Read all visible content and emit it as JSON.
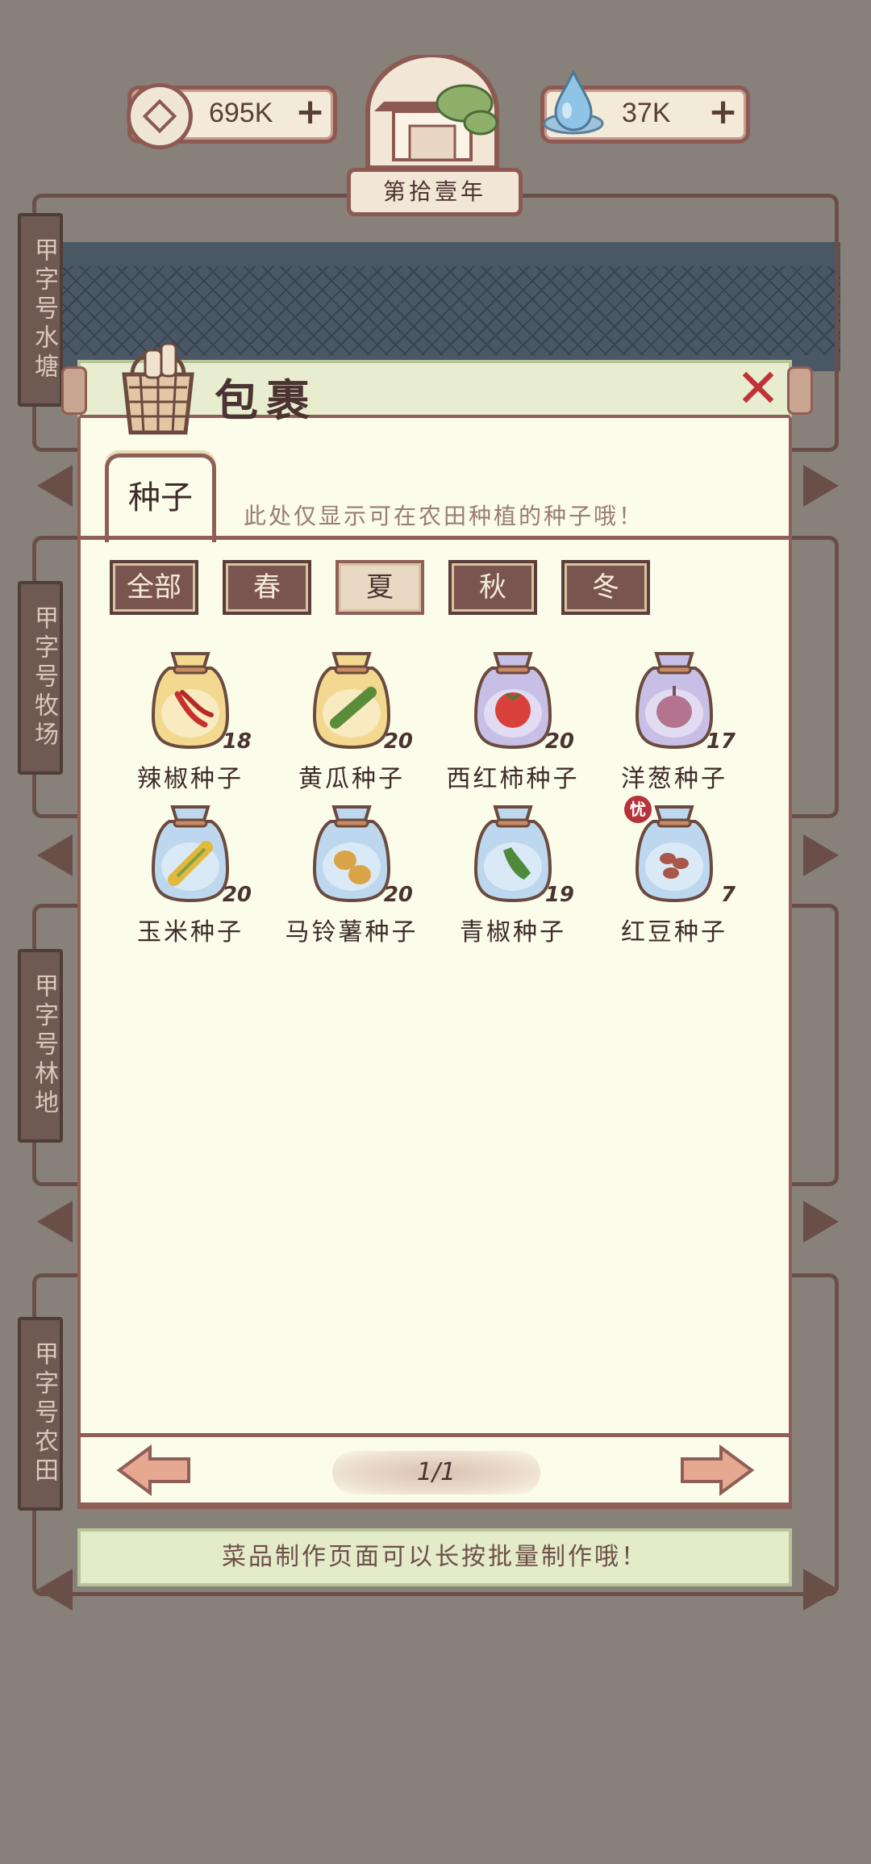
{
  "hud": {
    "coins": "695K",
    "gems": "37K",
    "plus": "+",
    "year": "第拾壹年"
  },
  "zones": [
    {
      "label": "甲字号水塘"
    },
    {
      "label": "甲字号牧场"
    },
    {
      "label": "甲字号林地"
    },
    {
      "label": "甲字号农田"
    }
  ],
  "panel": {
    "title": "包裹",
    "close": "✕",
    "tab": "种子",
    "hint": "此处仅显示可在农田种植的种子哦！",
    "filters": [
      "全部",
      "春",
      "夏",
      "秋",
      "冬"
    ],
    "active_filter": "夏",
    "items": [
      {
        "name": "辣椒种子",
        "count": "18",
        "bag_color": "#f3d98f",
        "icon": "chili-icon"
      },
      {
        "name": "黄瓜种子",
        "count": "20",
        "bag_color": "#f3d98f",
        "icon": "cucumber-icon"
      },
      {
        "name": "西红柿种子",
        "count": "20",
        "bag_color": "#c8bfe6",
        "icon": "tomato-icon"
      },
      {
        "name": "洋葱种子",
        "count": "17",
        "bag_color": "#c8bfe6",
        "icon": "onion-icon"
      },
      {
        "name": "玉米种子",
        "count": "20",
        "bag_color": "#bcd7ee",
        "icon": "corn-icon"
      },
      {
        "name": "马铃薯种子",
        "count": "20",
        "bag_color": "#bcd7ee",
        "icon": "potato-icon"
      },
      {
        "name": "青椒种子",
        "count": "19",
        "bag_color": "#bcd7ee",
        "icon": "green-pepper-icon"
      },
      {
        "name": "红豆种子",
        "count": "7",
        "bag_color": "#bcd7ee",
        "icon": "red-bean-icon",
        "badge": "忧"
      }
    ],
    "page": "1/1",
    "tip": "菜品制作页面可以长按批量制作哦！"
  }
}
